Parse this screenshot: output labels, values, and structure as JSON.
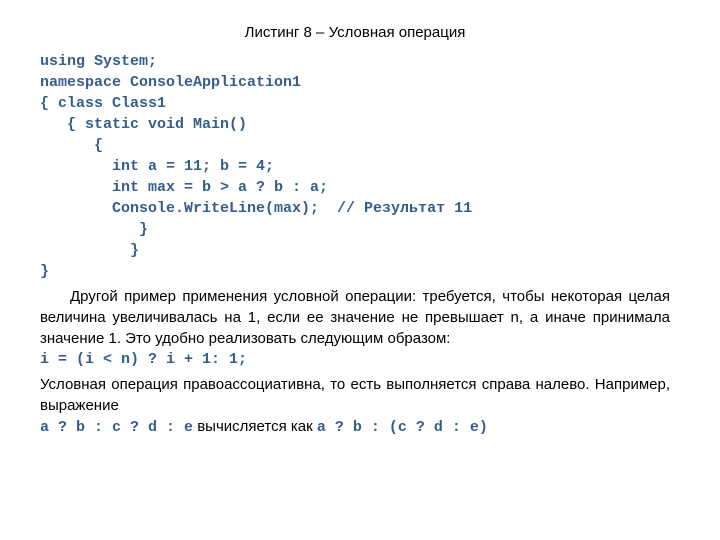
{
  "title": "Листинг 8 – Условная операция",
  "code": {
    "l1": "using System;",
    "l2": "namespace ConsoleApplication1",
    "l3": "{ class Class1",
    "l4": "   { static void Main()",
    "l5": "      {",
    "l6": "        int a = 11; b = 4;",
    "l7": "        int max = b > a ? b : a;",
    "l8": "        Console.WriteLine(max);  // Результат 11",
    "l9": "           }",
    "l10": "          }",
    "l11": "}"
  },
  "para1": "Другой пример применения условной операции: требуется, чтобы некоторая целая величина увеличивалась на 1, если ее значение не превышает n, а иначе принимала значение 1. Это удобно реализовать следующим образом:",
  "expr1": "i = (i < n) ? i + 1: 1;",
  "para2": "Условная операция правоассоциативна, то есть выполняется справа налево. Например, выражение",
  "final": {
    "left": "a ? b : с ? d : е",
    "mid": "   вычисляется как   ",
    "right": "a ? b : (с ? d : е)"
  }
}
